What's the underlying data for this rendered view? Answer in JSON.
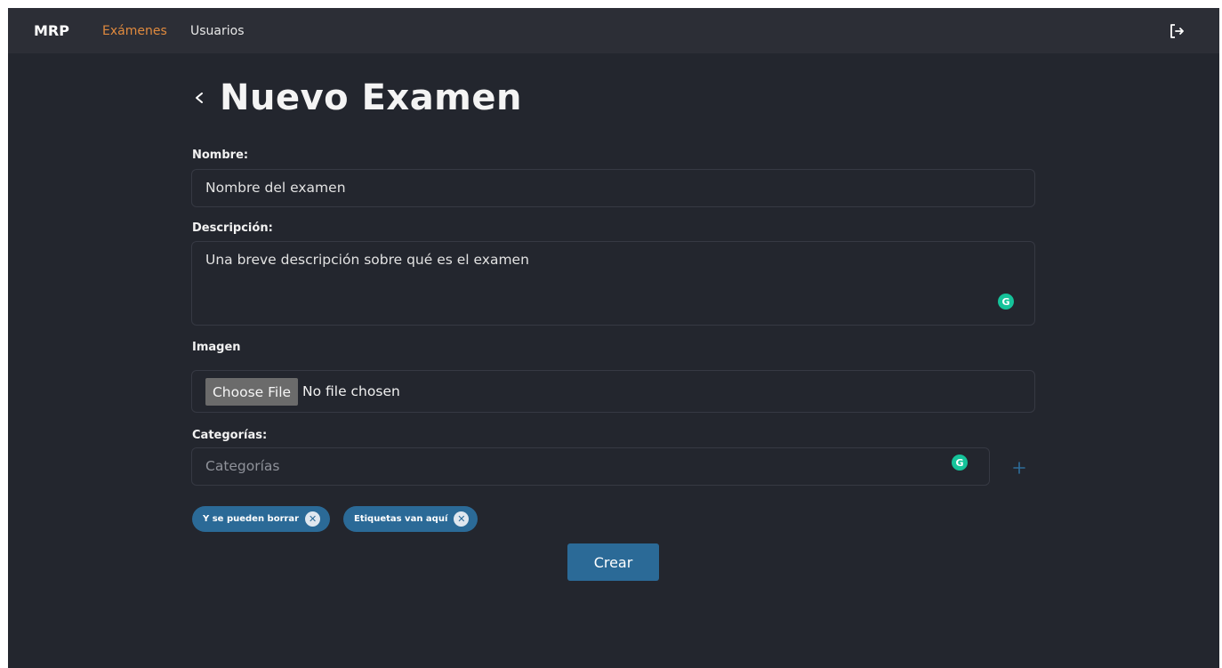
{
  "nav": {
    "brand": "MRP",
    "links": [
      {
        "label": "Exámenes",
        "active": true
      },
      {
        "label": "Usuarios",
        "active": false
      }
    ],
    "logout_icon": "logout-icon"
  },
  "page": {
    "title": "Nuevo Examen",
    "back_icon": "chevron-left-icon"
  },
  "form": {
    "nombre": {
      "label": "Nombre:",
      "value": "Nombre del examen"
    },
    "descripcion": {
      "label": "Descripción:",
      "value": "Una breve descripción sobre qué es el examen"
    },
    "imagen": {
      "label": "Imagen",
      "button_label": "Choose File",
      "status": "No file chosen"
    },
    "categorias": {
      "label": "Categorías:",
      "placeholder": "Categorías",
      "add_icon": "plus-icon"
    },
    "tags": [
      {
        "label": "Y se pueden borrar"
      },
      {
        "label": "Etiquetas van aquí"
      }
    ],
    "submit_label": "Crear"
  },
  "grammarly": {
    "glyph": "G"
  },
  "colors": {
    "background": "#23262e",
    "navbar": "#2c2e36",
    "accent": "#e08a3e",
    "primary": "#2b6a97",
    "grammarly": "#15c39a"
  }
}
